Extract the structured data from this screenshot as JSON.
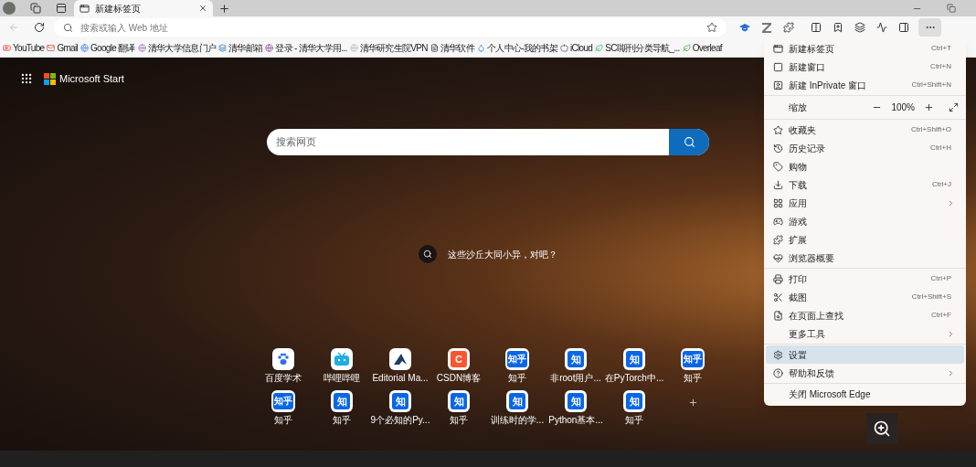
{
  "tabs": [
    {
      "title": "新建标签页",
      "selected": true
    }
  ],
  "nav": {
    "back_disabled": true
  },
  "address_bar": {
    "placeholder": "搜索或输入 Web 地址"
  },
  "bookmarks": [
    {
      "label": "YouTube"
    },
    {
      "label": "Gmail"
    },
    {
      "label": "Google 翻译"
    },
    {
      "label": "清华大学信息门户"
    },
    {
      "label": "清华邮箱"
    },
    {
      "label": "登录 - 清华大学用..."
    },
    {
      "label": "清华研究生院VPN"
    },
    {
      "label": "清华软件"
    },
    {
      "label": "个人中心-我的书架"
    },
    {
      "label": "iCloud"
    },
    {
      "label": "SCI期刊分类导航_..."
    },
    {
      "label": "Overleaf"
    }
  ],
  "page": {
    "brand": "Microsoft Start",
    "search": {
      "placeholder": "搜索网页"
    },
    "caption": "这些沙丘大同小异，对吧？",
    "quick_links": [
      {
        "label": "百度学术",
        "kind": "paw"
      },
      {
        "label": "哔哩哔哩",
        "kind": "tv"
      },
      {
        "label": "Editorial Ma...",
        "kind": "editorial"
      },
      {
        "label": "CSDN博客",
        "kind": "glyph",
        "glyph": "C",
        "color": "#fc5531"
      },
      {
        "label": "知乎",
        "kind": "glyph",
        "glyph": "知乎",
        "color": "#0a66e8"
      },
      {
        "label": "非root用户...",
        "kind": "glyph",
        "glyph": "知",
        "color": "#0a66e8"
      },
      {
        "label": "在PyTorch中...",
        "kind": "glyph",
        "glyph": "知",
        "color": "#0a66e8"
      },
      {
        "label": "知乎",
        "kind": "glyph",
        "glyph": "知乎",
        "color": "#0a66e8"
      },
      {
        "label": "知乎",
        "kind": "glyph",
        "glyph": "知乎",
        "color": "#0a66e8"
      },
      {
        "label": "知乎",
        "kind": "glyph",
        "glyph": "知",
        "color": "#0a66e8"
      },
      {
        "label": "9个必知的Py...",
        "kind": "glyph",
        "glyph": "知",
        "color": "#0a66e8"
      },
      {
        "label": "知乎",
        "kind": "glyph",
        "glyph": "知",
        "color": "#0a66e8"
      },
      {
        "label": "训练时的学...",
        "kind": "glyph",
        "glyph": "知",
        "color": "#0a66e8"
      },
      {
        "label": "Python基本...",
        "kind": "glyph",
        "glyph": "知",
        "color": "#0a66e8"
      },
      {
        "label": "知乎",
        "kind": "glyph",
        "glyph": "知",
        "color": "#0a66e8"
      },
      {
        "kind": "add"
      }
    ]
  },
  "menu": {
    "groups": [
      [
        {
          "kind": "item",
          "label": "新建标签页",
          "shortcut": "Ctrl+T",
          "submenu": false,
          "highlighted": false
        },
        {
          "kind": "item",
          "label": "新建窗口",
          "shortcut": "Ctrl+N",
          "submenu": false,
          "highlighted": false
        },
        {
          "kind": "item",
          "label": "新建 InPrivate 窗口",
          "shortcut": "Ctrl+Shift+N",
          "submenu": false,
          "highlighted": false
        }
      ],
      [
        {
          "kind": "zoom",
          "label": "缩放",
          "value": "100%"
        }
      ],
      [
        {
          "kind": "item",
          "label": "收藏夹",
          "shortcut": "Ctrl+Shift+O",
          "submenu": false,
          "highlighted": false
        },
        {
          "kind": "item",
          "label": "历史记录",
          "shortcut": "Ctrl+H",
          "submenu": false,
          "highlighted": false
        },
        {
          "kind": "item",
          "label": "购物",
          "submenu": false,
          "highlighted": false
        },
        {
          "kind": "item",
          "label": "下载",
          "shortcut": "Ctrl+J",
          "submenu": false,
          "highlighted": false
        },
        {
          "kind": "item",
          "label": "应用",
          "submenu": true,
          "highlighted": false
        },
        {
          "kind": "item",
          "label": "游戏",
          "submenu": false,
          "highlighted": false
        },
        {
          "kind": "item",
          "label": "扩展",
          "submenu": false,
          "highlighted": false
        },
        {
          "kind": "item",
          "label": "浏览器概要",
          "submenu": false,
          "highlighted": false
        }
      ],
      [
        {
          "kind": "item",
          "label": "打印",
          "shortcut": "Ctrl+P",
          "submenu": false,
          "highlighted": false
        },
        {
          "kind": "item",
          "label": "截图",
          "shortcut": "Ctrl+Shift+S",
          "submenu": false,
          "highlighted": false
        },
        {
          "kind": "item",
          "label": "在页面上查找",
          "shortcut": "Ctrl+F",
          "submenu": false,
          "highlighted": false
        },
        {
          "kind": "item",
          "label": "更多工具",
          "submenu": true,
          "highlighted": false
        }
      ],
      [
        {
          "kind": "item",
          "label": "设置",
          "submenu": false,
          "highlighted": true
        },
        {
          "kind": "item",
          "label": "帮助和反馈",
          "submenu": true,
          "highlighted": false
        }
      ],
      [
        {
          "kind": "item",
          "label": "关闭 Microsoft Edge",
          "submenu": false,
          "highlighted": false
        }
      ]
    ]
  }
}
